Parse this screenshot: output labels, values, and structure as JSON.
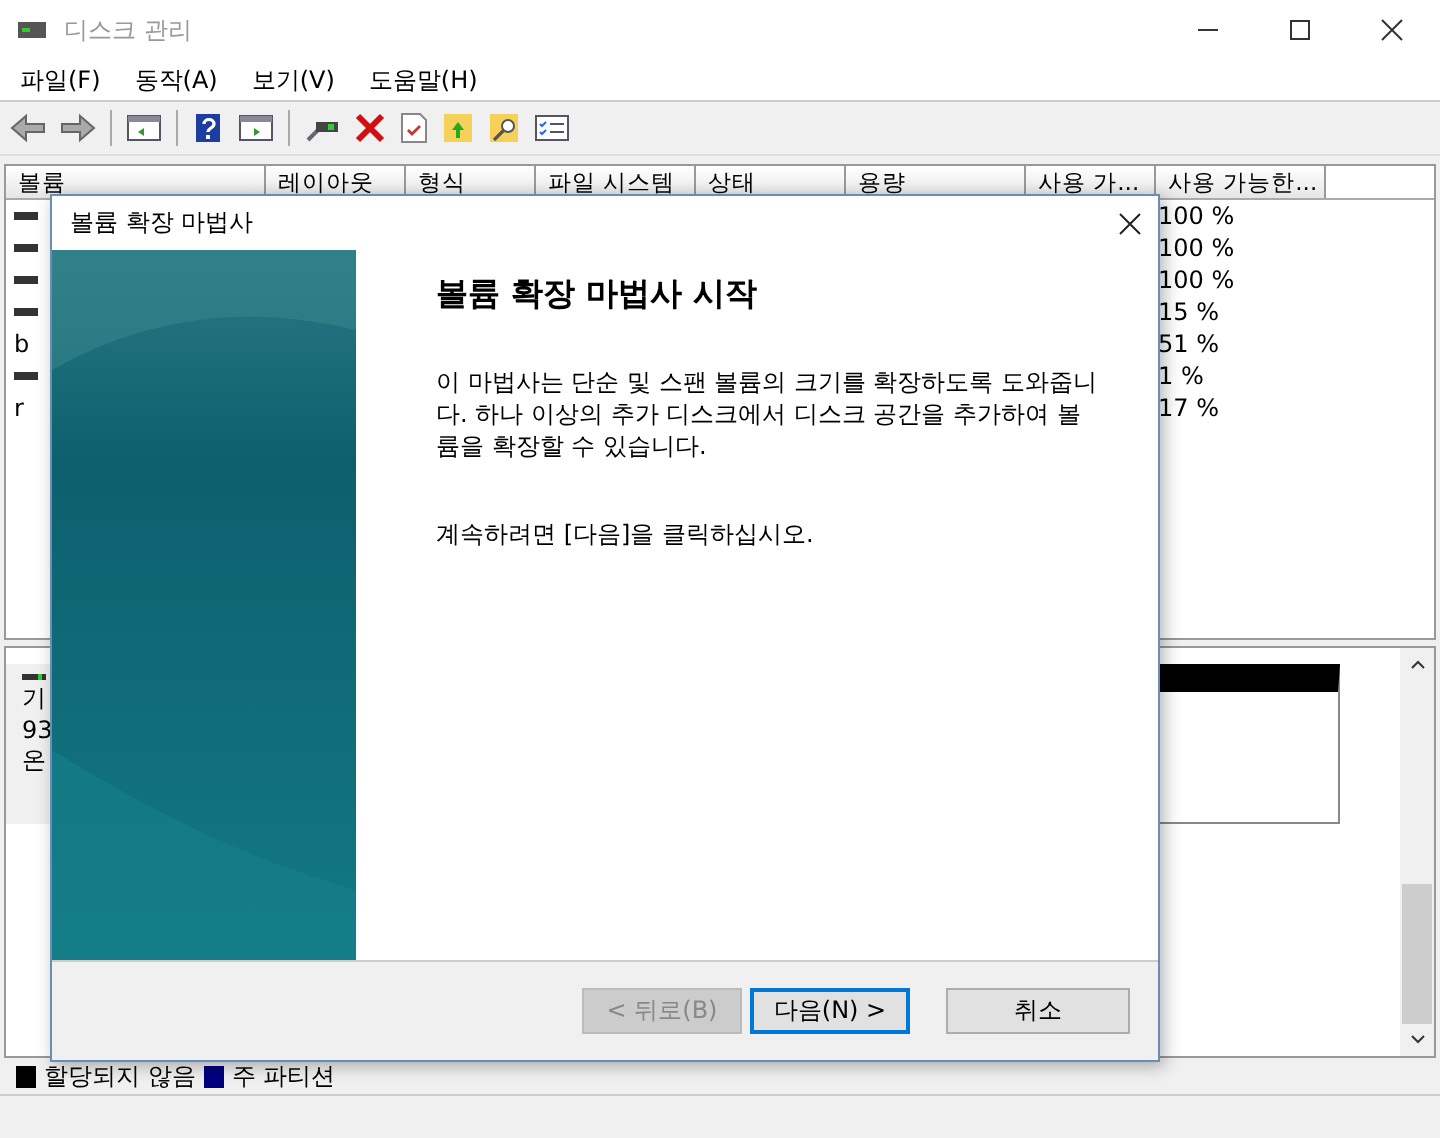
{
  "window": {
    "title": "디스크 관리"
  },
  "menu": [
    "파일(F)",
    "동작(A)",
    "보기(V)",
    "도움말(H)"
  ],
  "volume_table": {
    "columns": [
      "볼륨",
      "레이아웃",
      "형식",
      "파일 시스템",
      "상태",
      "용량",
      "사용 가...",
      "사용 가능한..."
    ],
    "rows": [
      {
        "free_percent": "100 %"
      },
      {
        "free_percent": "100 %"
      },
      {
        "free_percent": "100 %"
      },
      {
        "free_percent": "15 %"
      },
      {
        "volume": "b",
        "free_percent": "51 %"
      },
      {
        "free_percent": "1 %"
      },
      {
        "volume": "r",
        "free_percent": "17 %"
      }
    ]
  },
  "disk_label": [
    "기",
    "93",
    "온"
  ],
  "legend": [
    {
      "label": "할당되지 않음",
      "color": "#000000"
    },
    {
      "label": "주 파티션",
      "color": "#000080"
    }
  ],
  "wizard": {
    "title": "볼륨 확장 마법사",
    "heading": "볼륨 확장 마법사 시작",
    "paragraphs": [
      "이 마법사는 단순 및 스팬 볼륨의 크기를 확장하도록 도와줍니다. 하나 이상의 추가 디스크에서 디스크 공간을 추가하여 볼륨을 확장할 수 있습니다.",
      "계속하려면 [다음]을 클릭하십시오."
    ],
    "buttons": [
      {
        "label": "< 뒤로(B)",
        "disabled": true,
        "default": false
      },
      {
        "label": "다음(N) >",
        "disabled": false,
        "default": true
      },
      {
        "label": "취소",
        "disabled": false,
        "default": false
      }
    ]
  }
}
